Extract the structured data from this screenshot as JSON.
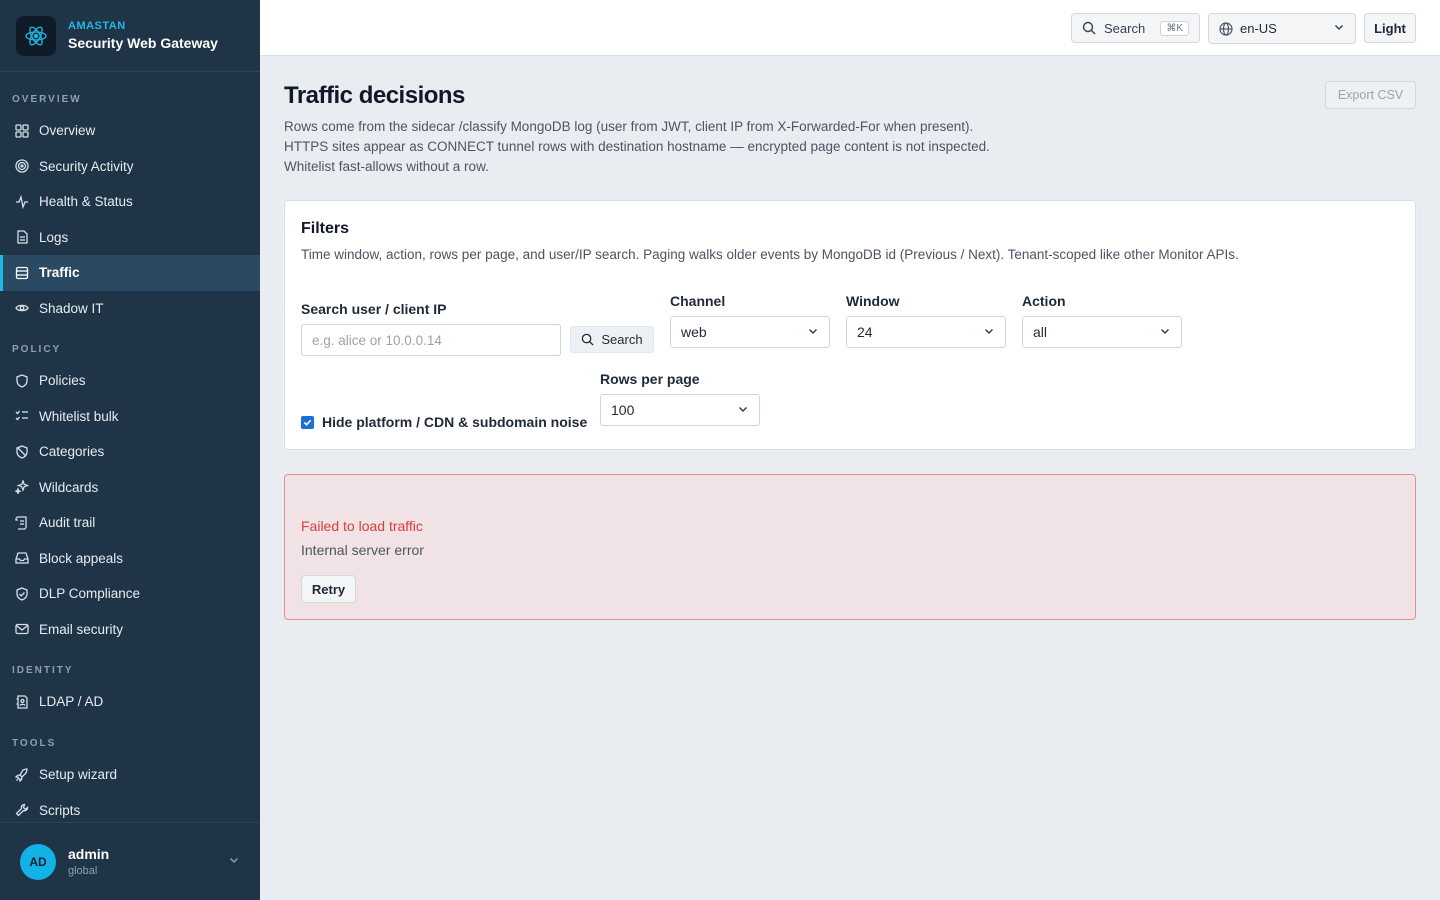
{
  "brand": {
    "org": "AMASTAN",
    "product": "Security Web Gateway",
    "logo_icon": "atom-logo-icon"
  },
  "colors": {
    "sidebar_bg": "#1f3447",
    "accent": "#22b8e6",
    "error": "#e03b3b",
    "checkbox": "#1a6fd6"
  },
  "sidebar": {
    "sections": {
      "overview": "OVERVIEW",
      "policy": "POLICY",
      "identity": "IDENTITY",
      "tools": "TOOLS"
    },
    "items": [
      {
        "label": "Overview",
        "icon": "grid-icon"
      },
      {
        "label": "Security Activity",
        "icon": "radar-icon"
      },
      {
        "label": "Health & Status",
        "icon": "pulse-icon"
      },
      {
        "label": "Logs",
        "icon": "document-icon"
      },
      {
        "label": "Traffic",
        "icon": "list-icon",
        "active": true
      },
      {
        "label": "Shadow IT",
        "icon": "eye-icon"
      },
      {
        "label": "Policies",
        "icon": "shield-icon"
      },
      {
        "label": "Whitelist bulk",
        "icon": "checklist-icon"
      },
      {
        "label": "Categories",
        "icon": "shield-slash-icon"
      },
      {
        "label": "Wildcards",
        "icon": "sparkle-icon"
      },
      {
        "label": "Audit trail",
        "icon": "scroll-icon"
      },
      {
        "label": "Block appeals",
        "icon": "inbox-icon"
      },
      {
        "label": "DLP Compliance",
        "icon": "shield-check-icon"
      },
      {
        "label": "Email security",
        "icon": "mail-icon"
      },
      {
        "label": "LDAP / AD",
        "icon": "address-book-icon"
      },
      {
        "label": "Setup wizard",
        "icon": "rocket-icon"
      },
      {
        "label": "Scripts",
        "icon": "wrench-icon"
      }
    ],
    "user": {
      "initials": "AD",
      "name": "admin",
      "scope": "global"
    }
  },
  "topbar": {
    "search_label": "Search",
    "search_shortcut": "⌘K",
    "locale": "en-US",
    "theme": "Light"
  },
  "page": {
    "title": "Traffic decisions",
    "export_label": "Export CSV",
    "description": [
      "Rows come from the sidecar /classify MongoDB log (user from JWT, client IP from X-Forwarded-For when present).",
      "HTTPS sites appear as CONNECT tunnel rows with destination hostname — encrypted page content is not inspected.",
      "Whitelist fast-allows without a row."
    ]
  },
  "filters": {
    "title": "Filters",
    "description": "Time window, action, rows per page, and user/IP search. Paging walks older events by MongoDB id (Previous / Next). Tenant-scoped like other Monitor APIs.",
    "search_label": "Search user / client IP",
    "search_placeholder": "e.g. alice or 10.0.0.14",
    "search_button": "Search",
    "channel_label": "Channel",
    "channel_value": "web",
    "window_label": "Window",
    "window_value": "24",
    "action_label": "Action",
    "action_value": "all",
    "rows_label": "Rows per page",
    "rows_value": "100",
    "hide_noise_label": "Hide platform / CDN & subdomain noise",
    "hide_noise_checked": true
  },
  "error": {
    "title": "Failed to load traffic",
    "message": "Internal server error",
    "retry_label": "Retry"
  }
}
